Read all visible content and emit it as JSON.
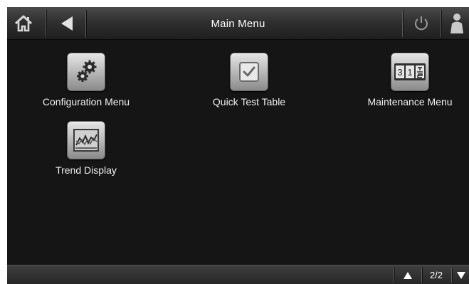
{
  "header": {
    "title": "Main Menu",
    "home_icon": "home-icon",
    "back_icon": "back-arrow-icon",
    "power_icon": "power-icon",
    "user_icon": "user-icon"
  },
  "menu": {
    "items": [
      {
        "label": "Configuration Menu",
        "icon": "gears-icon"
      },
      {
        "label": "Quick Test Table",
        "icon": "checkbox-icon"
      },
      {
        "label": "Maintenance Menu",
        "icon": "calendar-counter-icon"
      },
      {
        "label": "Trend Display",
        "icon": "trend-chart-icon"
      }
    ],
    "counter_digits": [
      "3",
      "1"
    ]
  },
  "footer": {
    "page_indicator": "2/2",
    "up_icon": "page-up-icon",
    "down_icon": "page-down-icon"
  },
  "colors": {
    "background": "#151515",
    "header": "#303030",
    "text": "#ffffff",
    "icon_tile": "#bdbdbd"
  }
}
